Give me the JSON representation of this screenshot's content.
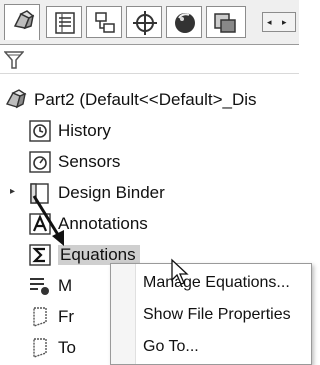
{
  "toolbar": {
    "tabs": [
      {
        "icon": "feature-manager-icon"
      },
      {
        "icon": "property-manager-icon"
      },
      {
        "icon": "configuration-manager-icon"
      },
      {
        "icon": "dimxpert-manager-icon"
      },
      {
        "icon": "display-manager-icon"
      },
      {
        "icon": "extra-tab-icon"
      }
    ],
    "scroll_left": "◂",
    "scroll_right": "▸"
  },
  "tree": {
    "root_label": "Part2  (Default<<Default>_Dis",
    "items": [
      {
        "label": "History",
        "icon": "history-icon"
      },
      {
        "label": "Sensors",
        "icon": "sensors-icon"
      },
      {
        "label": "Design Binder",
        "icon": "design-binder-icon"
      },
      {
        "label": "Annotations",
        "icon": "annotations-icon"
      },
      {
        "label": "Equations",
        "icon": "equations-icon"
      },
      {
        "label": "M",
        "icon": "material-icon"
      },
      {
        "label": "Fr",
        "icon": "front-plane-icon"
      },
      {
        "label": "To",
        "icon": "top-plane-icon"
      }
    ],
    "expander": "▸"
  },
  "context_menu": {
    "items": [
      {
        "label": "Manage Equations..."
      },
      {
        "label": "Show File Properties"
      },
      {
        "label": "Go To..."
      }
    ]
  },
  "colors": {
    "selection": "#cfcfcf",
    "menu_border": "#9a9a9a"
  }
}
